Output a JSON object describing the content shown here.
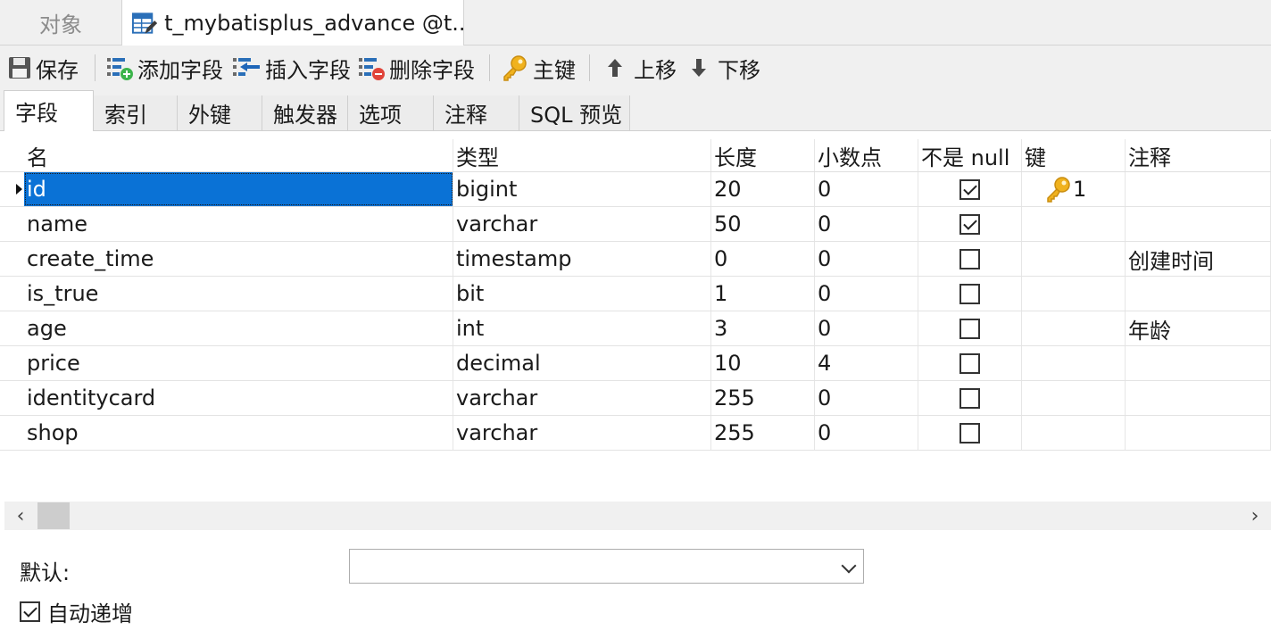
{
  "doc_tabs": {
    "objects": "对象",
    "table_design": "t_mybatisplus_advance @t..."
  },
  "toolbar": {
    "save": "保存",
    "add_field": "添加字段",
    "insert_field": "插入字段",
    "delete_field": "删除字段",
    "primary_key": "主键",
    "move_up": "上移",
    "move_down": "下移"
  },
  "sub_tabs": [
    "字段",
    "索引",
    "外键",
    "触发器",
    "选项",
    "注释",
    "SQL 预览"
  ],
  "columns": {
    "name": "名",
    "type": "类型",
    "length": "长度",
    "decimals": "小数点",
    "not_null": "不是 null",
    "key": "键",
    "comment": "注释"
  },
  "rows": [
    {
      "name": "id",
      "type": "bigint",
      "length": "20",
      "decimals": "0",
      "not_null": true,
      "key": "1",
      "comment": ""
    },
    {
      "name": "name",
      "type": "varchar",
      "length": "50",
      "decimals": "0",
      "not_null": true,
      "key": "",
      "comment": ""
    },
    {
      "name": "create_time",
      "type": "timestamp",
      "length": "0",
      "decimals": "0",
      "not_null": false,
      "key": "",
      "comment": "创建时间"
    },
    {
      "name": "is_true",
      "type": "bit",
      "length": "1",
      "decimals": "0",
      "not_null": false,
      "key": "",
      "comment": ""
    },
    {
      "name": "age",
      "type": "int",
      "length": "3",
      "decimals": "0",
      "not_null": false,
      "key": "",
      "comment": "年龄"
    },
    {
      "name": "price",
      "type": "decimal",
      "length": "10",
      "decimals": "4",
      "not_null": false,
      "key": "",
      "comment": ""
    },
    {
      "name": "identitycard",
      "type": "varchar",
      "length": "255",
      "decimals": "0",
      "not_null": false,
      "key": "",
      "comment": ""
    },
    {
      "name": "shop",
      "type": "varchar",
      "length": "255",
      "decimals": "0",
      "not_null": false,
      "key": "",
      "comment": ""
    }
  ],
  "properties": {
    "default_label": "默认:",
    "default_value": "",
    "auto_increment_label": "自动递增",
    "auto_increment": true
  },
  "colors": {
    "selection": "#0a72d6",
    "key_gold": "#f0b21e",
    "add_green": "#3cb44b",
    "delete_red": "#e0443a"
  },
  "icons": {
    "table_design_tab": "table-edit-icon",
    "save": "save-icon",
    "add_field": "add-field-icon",
    "insert_field": "insert-field-icon",
    "delete_field": "delete-field-icon",
    "primary_key": "key-icon",
    "move_up": "arrow-up-icon",
    "move_down": "arrow-down-icon"
  }
}
